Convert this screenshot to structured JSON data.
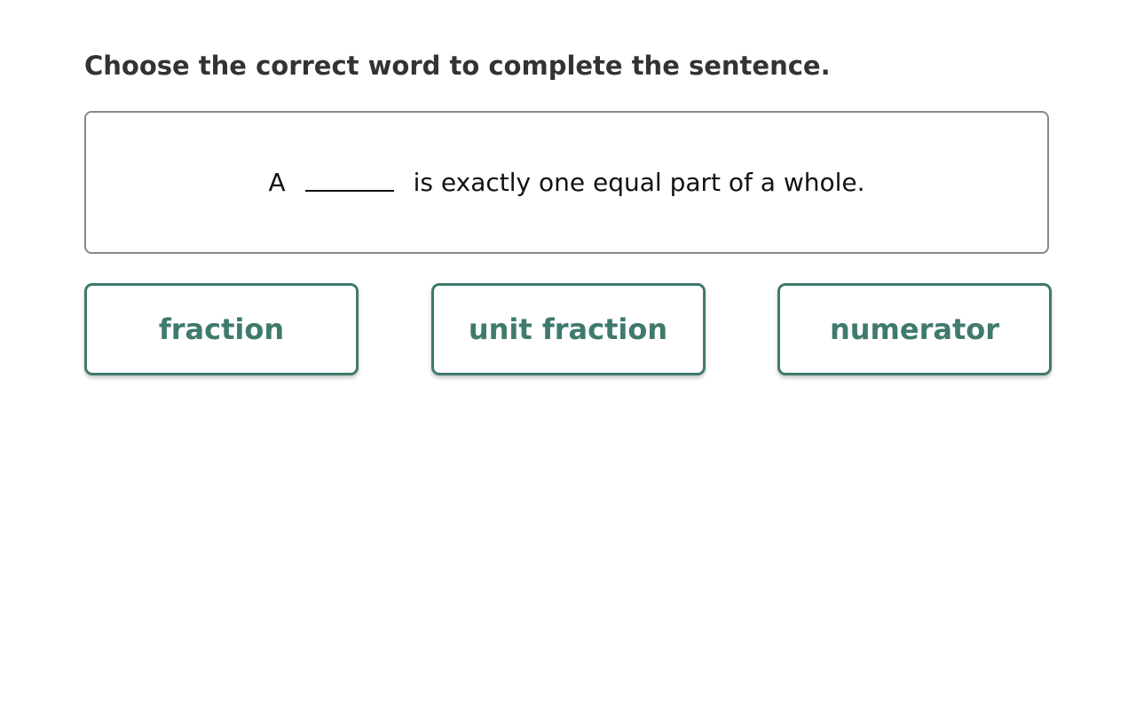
{
  "prompt": "Choose the correct word to complete the sentence.",
  "sentence": {
    "before": "A",
    "after": "is exactly one equal part of a whole."
  },
  "choices": [
    {
      "label": "fraction"
    },
    {
      "label": "unit fraction"
    },
    {
      "label": "numerator"
    }
  ],
  "colors": {
    "accent": "#3f7a6d",
    "text": "#333333",
    "box_border": "#888888"
  }
}
